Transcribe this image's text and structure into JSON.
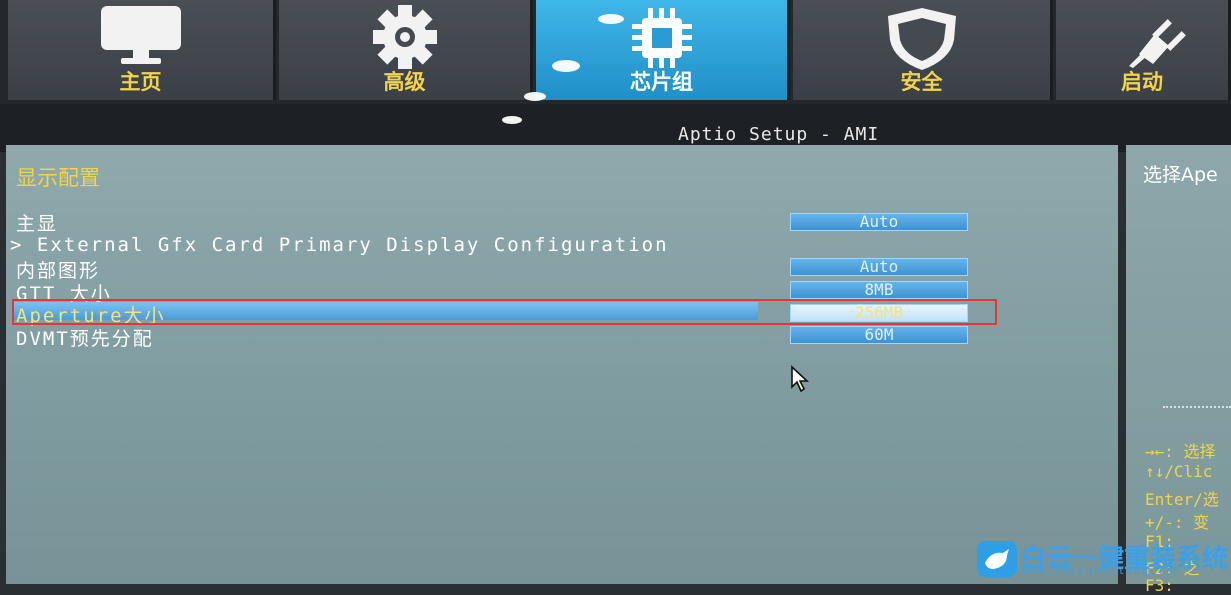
{
  "tabs": [
    {
      "label": "主页",
      "icon": "monitor-icon",
      "active": false
    },
    {
      "label": "高级",
      "icon": "gear-icon",
      "active": false
    },
    {
      "label": "芯片组",
      "icon": "chip-icon",
      "active": true
    },
    {
      "label": "安全",
      "icon": "shield-icon",
      "active": false
    },
    {
      "label": "启动",
      "icon": "power-plug-icon",
      "active": false
    }
  ],
  "header": {
    "title": "Aptio Setup - AMI"
  },
  "section": {
    "title": "显示配置"
  },
  "rows": [
    {
      "label": "主显",
      "value": "Auto"
    },
    {
      "label": "> External Gfx Card Primary Display Configuration"
    },
    {
      "label": "内部图形",
      "value": "Auto"
    },
    {
      "label": "GTT 大小",
      "value": "8MB"
    },
    {
      "label": "Aperture大小",
      "value": "256MB",
      "selected": true
    },
    {
      "label": "DVMT预先分配",
      "value": "60M"
    }
  ],
  "help": {
    "text": "选择Ape",
    "keys": [
      "→←: 选择",
      "↑↓/Clic",
      "Enter/选",
      "+/-: 变",
      "F1: ",
      "F2: 之",
      "F3: "
    ]
  },
  "watermark": {
    "text": "白云一键重装系统",
    "url": "www.baiyunxitong.com"
  },
  "colors": {
    "accent": "#2f9fd8",
    "label_yellow": "#f2d34a",
    "selection_frame": "#e1363a"
  }
}
